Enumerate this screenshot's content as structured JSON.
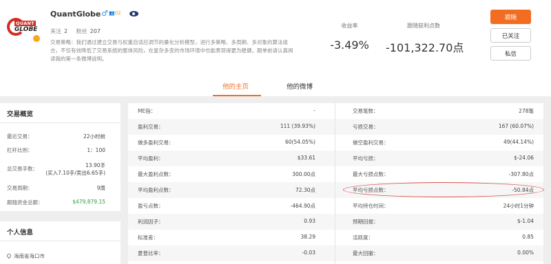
{
  "profile": {
    "name": "QuantGlobe",
    "gender_symbol": "♂",
    "level_text": "👥02",
    "logo": {
      "quant": "QUANT",
      "globe": "GLOBE"
    },
    "following_label": "关注",
    "following_count": "2",
    "fans_label": "粉丝",
    "fans_count": "207",
    "description": "交易策略：我们通过建立交易与权重自适应调节的量化分析模型，进行多策略、多周期、多对象的算法组合，不仅有效降低了交易系统的整体风险，在复杂多变的市场环境中也能表现得更为稳健。跟单前请认真阅读我的第一条微博说明。",
    "metrics": [
      {
        "label": "收益率",
        "value": "-3.49%"
      },
      {
        "label": "跟随获利点数",
        "value": "-101,322.70点"
      }
    ],
    "buttons": {
      "follow": "跟随",
      "followed": "已关注",
      "message": "私信"
    }
  },
  "tabs": [
    {
      "label": "他的主页",
      "active": true
    },
    {
      "label": "他的微博",
      "active": false
    }
  ],
  "overview": {
    "title": "交易概览",
    "rows": [
      {
        "k": "最近交易：",
        "v": "22小时前"
      },
      {
        "k": "杠杆比例：",
        "v": "1：100"
      },
      {
        "k": "总交易手数：",
        "v": "13.90手",
        "sub": "(买入7.10手/卖出6.65手)"
      },
      {
        "k": "交易周期：",
        "v": "9周"
      },
      {
        "k": "跟随资金总额：",
        "v": "$479,879.15"
      }
    ]
  },
  "personal": {
    "title": "个人信息",
    "location": "海南省海口市"
  },
  "stats": {
    "rows": [
      {
        "k1": "ME指：",
        "v1": "-",
        "k2": "交易笔数：",
        "v2": "278笔"
      },
      {
        "k1": "盈利交易：",
        "v1": "111 (39.93%)",
        "k2": "亏损交易：",
        "v2": "167 (60.07%)"
      },
      {
        "k1": "做多盈利交易：",
        "v1": "60(54.05%)",
        "k2": "做空盈利交易：",
        "v2": "49(44.14%)"
      },
      {
        "k1": "平均盈利：",
        "v1": "$33.61",
        "k2": "平均亏损：",
        "v2": "$-24.06"
      },
      {
        "k1": "最大盈利点数：",
        "v1": "300.00点",
        "k2": "最大亏损点数：",
        "v2": "-307.80点"
      },
      {
        "k1": "平均盈利点数：",
        "v1": "72.30点",
        "k2": "平均亏损点数：",
        "v2": "-50.84点"
      },
      {
        "k1": "盈亏点数：",
        "v1": "-464.90点",
        "k2": "平均持仓时间：",
        "v2": "24小时1分钟"
      },
      {
        "k1": "利润因子：",
        "v1": "0.93",
        "k2": "预期回报：",
        "v2": "$-1.04"
      },
      {
        "k1": "标准差：",
        "v1": "38.29",
        "k2": "活跃度：",
        "v2": "0.85"
      },
      {
        "k1": "夏普比率：",
        "v1": "-0.03",
        "k2": "最大回撤：",
        "v2": "0.00%"
      }
    ]
  },
  "colors": {
    "accent": "#f26d21",
    "brand_red": "#d42b24",
    "positive_green": "#2a9d3e",
    "annotation_red": "#d9534f"
  }
}
